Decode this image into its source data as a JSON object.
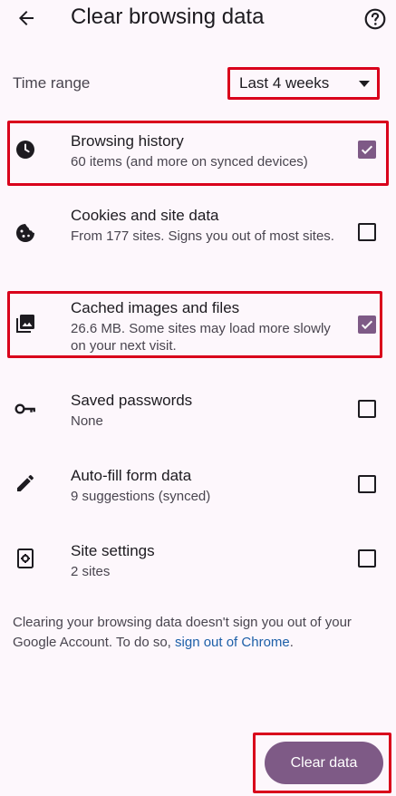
{
  "header": {
    "title": "Clear browsing data",
    "back_icon": "arrow-back-icon",
    "help_icon": "help-circle-icon"
  },
  "time_range": {
    "label": "Time range",
    "selected": "Last 4 weeks"
  },
  "options": [
    {
      "icon": "clock-icon",
      "title": "Browsing history",
      "subtitle": "60 items (and more on synced devices)",
      "checked": true,
      "highlighted": true
    },
    {
      "icon": "cookie-icon",
      "title": "Cookies and site data",
      "subtitle": "From 177 sites. Signs you out of most sites.",
      "checked": false,
      "highlighted": false
    },
    {
      "icon": "image-stack-icon",
      "title": "Cached images and files",
      "subtitle": "26.6 MB. Some sites may load more slowly on your next visit.",
      "checked": true,
      "highlighted": true
    },
    {
      "icon": "key-icon",
      "title": "Saved passwords",
      "subtitle": "None",
      "checked": false,
      "highlighted": false
    },
    {
      "icon": "pencil-icon",
      "title": "Auto-fill form data",
      "subtitle": "9 suggestions (synced)",
      "checked": false,
      "highlighted": false
    },
    {
      "icon": "site-settings-icon",
      "title": "Site settings",
      "subtitle": "2 sites",
      "checked": false,
      "highlighted": false
    }
  ],
  "note": {
    "text": "Clearing your browsing data doesn't sign you out of your Google Account. To do so, ",
    "link": "sign out of Chrome",
    "end": "."
  },
  "clear_button": {
    "label": "Clear data"
  },
  "colors": {
    "accent": "#7e5a86",
    "highlight": "#d9001b",
    "link": "#1d5fa8",
    "background": "#fdf7fc"
  }
}
